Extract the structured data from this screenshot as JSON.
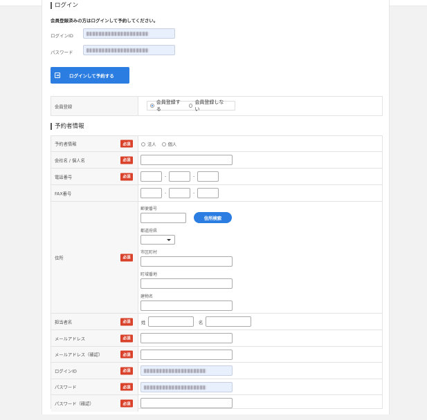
{
  "login": {
    "title": "ログイン",
    "note": "会員登録済みの方はログインして予約してください。",
    "id_label": "ログインID",
    "password_label": "パスワード",
    "button_label": "ログインして予約する",
    "button_icon": "login-icon"
  },
  "membership": {
    "label": "会員登録",
    "options": [
      "会員登録する",
      "会員登録しない"
    ],
    "selected": "会員登録する"
  },
  "booker": {
    "title": "予約者情報",
    "required_badge": "必須",
    "rows": {
      "type": {
        "label": "予約者情報",
        "options": [
          "法人",
          "個人"
        ]
      },
      "company": {
        "label": "会社名 / 個人名"
      },
      "phone": {
        "label": "電話番号",
        "sep": "-"
      },
      "fax": {
        "label": "FAX番号",
        "sep": "-"
      },
      "address": {
        "label": "住所",
        "postal_label": "郵便番号",
        "search_button": "住所検索",
        "prefecture_label": "都道府県",
        "city_label": "市区町村",
        "street_label": "町域番地",
        "building_label": "建物名"
      },
      "contact": {
        "label": "担当者名",
        "last_prefix": "姓",
        "first_prefix": "名"
      },
      "email": {
        "label": "メールアドレス"
      },
      "email_confirm": {
        "label": "メールアドレス（確認）"
      },
      "login_id": {
        "label": "ログインID"
      },
      "password": {
        "label": "パスワード"
      },
      "password_confirm": {
        "label": "パスワード（確認）"
      }
    }
  }
}
